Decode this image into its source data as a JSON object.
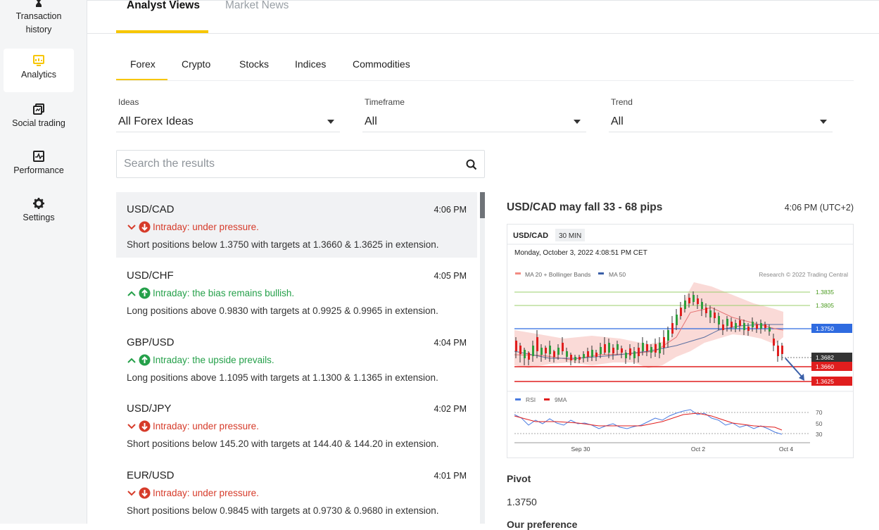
{
  "sidebar": {
    "items": [
      {
        "label_line1": "Transaction",
        "label_line2": "history",
        "icon": "hourglass-icon"
      },
      {
        "label": "Analytics",
        "icon": "analytics-icon",
        "active": true
      },
      {
        "label": "Social trading",
        "icon": "social-trading-icon"
      },
      {
        "label": "Performance",
        "icon": "performance-icon"
      },
      {
        "label": "Settings",
        "icon": "gear-icon"
      }
    ]
  },
  "top_tabs": [
    {
      "label": "Analyst Views",
      "active": true
    },
    {
      "label": "Market News",
      "active": false
    }
  ],
  "category_tabs": [
    {
      "label": "Forex",
      "active": true
    },
    {
      "label": "Crypto"
    },
    {
      "label": "Stocks"
    },
    {
      "label": "Indices"
    },
    {
      "label": "Commodities"
    }
  ],
  "filters": {
    "ideas": {
      "label": "Ideas",
      "value": "All Forex Ideas"
    },
    "timeframe": {
      "label": "Timeframe",
      "value": "All"
    },
    "trend": {
      "label": "Trend",
      "value": "All"
    }
  },
  "search": {
    "placeholder": "Search the results"
  },
  "ideas": [
    {
      "pair": "USD/CAD",
      "time": "4:06 PM",
      "trend": "bearish",
      "headline": "Intraday: under pressure.",
      "description": "Short positions below 1.3750 with targets at 1.3660 & 1.3625 in extension."
    },
    {
      "pair": "USD/CHF",
      "time": "4:05 PM",
      "trend": "bullish",
      "headline": "Intraday: the bias remains bullish.",
      "description": "Long positions above 0.9830 with targets at 0.9925 & 0.9965 in extension."
    },
    {
      "pair": "GBP/USD",
      "time": "4:04 PM",
      "trend": "bullish",
      "headline": "Intraday: the upside prevails.",
      "description": "Long positions above 1.1095 with targets at 1.1300 & 1.1365 in extension."
    },
    {
      "pair": "USD/JPY",
      "time": "4:02 PM",
      "trend": "bearish",
      "headline": "Intraday: under pressure.",
      "description": "Short positions below 145.20 with targets at 144.40 & 144.20 in extension."
    },
    {
      "pair": "EUR/USD",
      "time": "4:01 PM",
      "trend": "bearish",
      "headline": "Intraday: under pressure.",
      "description": "Short positions below 0.9845 with targets at 0.9730 & 0.9680 in extension."
    }
  ],
  "detail": {
    "title": "USD/CAD may fall 33 - 68 pips",
    "time": "4:06 PM (UTC+2)",
    "chart": {
      "symbol": "USD/CAD",
      "interval": "30 MIN",
      "date": "Monday, October 3, 2022 4:08:51 PM CET",
      "legend1": "MA 20 + Bollinger Bands",
      "legend2": "MA 50",
      "credit": "Research © 2022 Trading Central",
      "levels": [
        "1.3835",
        "1.3805",
        "1.3750",
        "1.3682",
        "1.3660",
        "1.3625"
      ],
      "rsi_legend1": "RSI",
      "rsi_legend2": "9MA",
      "rsi_levels": [
        "70",
        "50",
        "30"
      ],
      "x_labels": [
        "Sep 30",
        "Oct 2",
        "Oct 4"
      ]
    },
    "pivot_label": "Pivot",
    "pivot_value": "1.3750",
    "preference_label": "Our preference"
  },
  "colors": {
    "accent": "#f7c600",
    "bearish": "#d63b2a",
    "bullish": "#25a04a"
  }
}
